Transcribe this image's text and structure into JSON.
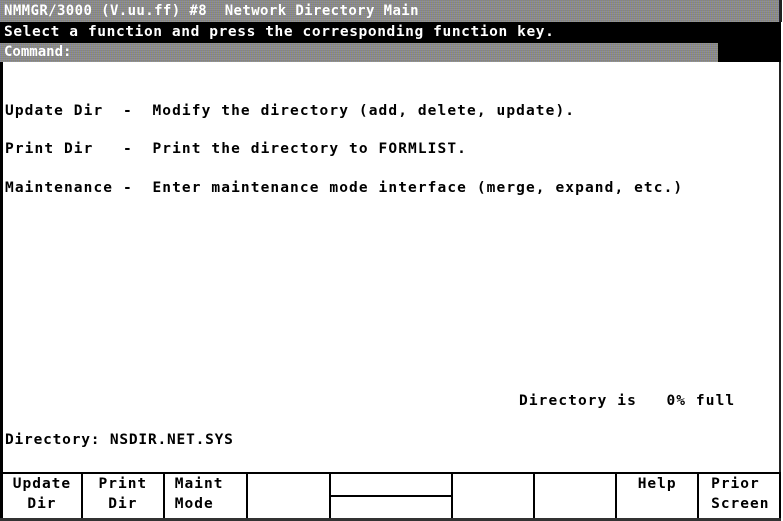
{
  "header": {
    "title": "NMMGR/3000 (V.uu.ff) #8  Network Directory Main",
    "prompt": "Select a function and press the corresponding function key.",
    "command_label": "Command:",
    "command_value": ""
  },
  "menu": [
    {
      "label": "Update Dir",
      "sep": "-",
      "description": "Modify the directory (add, delete, update)."
    },
    {
      "label": "Print Dir",
      "sep": "-",
      "description": "Print the directory to FORMLIST."
    },
    {
      "label": "Maintenance",
      "sep": "-",
      "description": "Enter maintenance mode interface (merge, expand, etc.)"
    }
  ],
  "menu_lines": [
    "Update Dir  -  Modify the directory (add, delete, update).",
    "Print Dir   -  Print the directory to FORMLIST.",
    "Maintenance -  Enter maintenance mode interface (merge, expand, etc.)"
  ],
  "status": {
    "text": "Directory is   0% full",
    "percent_full": 0
  },
  "directory": {
    "text": "Directory: NSDIR.NET.SYS",
    "name": "NSDIR.NET.SYS"
  },
  "function_keys": [
    {
      "key": "f1",
      "line1": "Update",
      "line2": "Dir"
    },
    {
      "key": "f2",
      "line1": "Print",
      "line2": "Dir"
    },
    {
      "key": "f3",
      "line1": "Maint",
      "line2": "Mode"
    },
    {
      "key": "f4",
      "line1": "",
      "line2": ""
    },
    {
      "key": "f5",
      "line1": "",
      "line2": ""
    },
    {
      "key": "f6",
      "line1": "",
      "line2": ""
    },
    {
      "key": "f7",
      "line1": "",
      "line2": ""
    },
    {
      "key": "f8",
      "line1": "Help",
      "line2": ""
    },
    {
      "key": "f9",
      "line1": "Prior",
      "line2": "Screen"
    }
  ]
}
